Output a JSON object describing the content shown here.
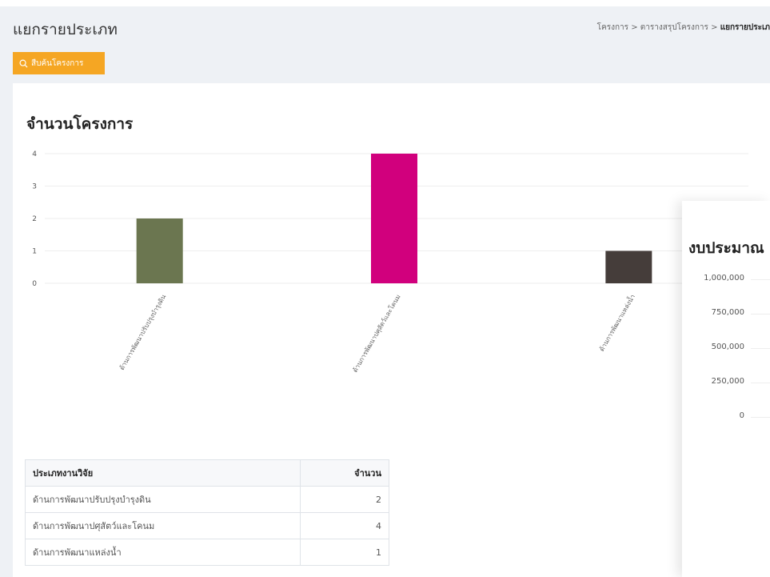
{
  "header": {
    "title": "แยกรายประเภท",
    "breadcrumb": [
      {
        "label": "โครงการ"
      },
      {
        "label": "ตารางสรุปโครงการ"
      },
      {
        "label": "แยกรายประเภ"
      }
    ],
    "separator": ">"
  },
  "toolbar": {
    "search_label": "สืบค้นโครงการ",
    "accent_color": "#f5a623"
  },
  "main_card": {
    "title": "จำนวนโครงการ"
  },
  "chart_data": [
    {
      "type": "bar",
      "title": "จำนวนโครงการ",
      "categories": [
        "ด้านการพัฒนาปรับปรุงบำรุงดิน",
        "ด้านการพัฒนาปศุสัตว์และโคนม",
        "ด้านการพัฒนาแหล่งน้ำ"
      ],
      "values": [
        2,
        4,
        1
      ],
      "colors": [
        "#6b7650",
        "#d1007d",
        "#453d3a"
      ],
      "ylim": [
        0,
        4
      ],
      "yticks": [
        0,
        1,
        2,
        3,
        4
      ],
      "grid": true,
      "xlabel": "",
      "ylabel": ""
    },
    {
      "type": "bar",
      "title": "งบประมาณ",
      "yticks": [
        "1,000,000",
        "750,000",
        "500,000",
        "250,000",
        "0"
      ],
      "ylim": [
        0,
        1000000
      ],
      "grid": true
    }
  ],
  "table": {
    "headers": {
      "type": "ประเภทงานวิจัย",
      "count": "จำนวน"
    },
    "rows": [
      {
        "type": "ด้านการพัฒนาปรับปรุงบำรุงดิน",
        "count": "2"
      },
      {
        "type": "ด้านการพัฒนาปศุสัตว์และโคนม",
        "count": "4"
      },
      {
        "type": "ด้านการพัฒนาแหล่งน้ำ",
        "count": "1"
      }
    ]
  },
  "second_card": {
    "title_visible": "งบประมาณ"
  }
}
